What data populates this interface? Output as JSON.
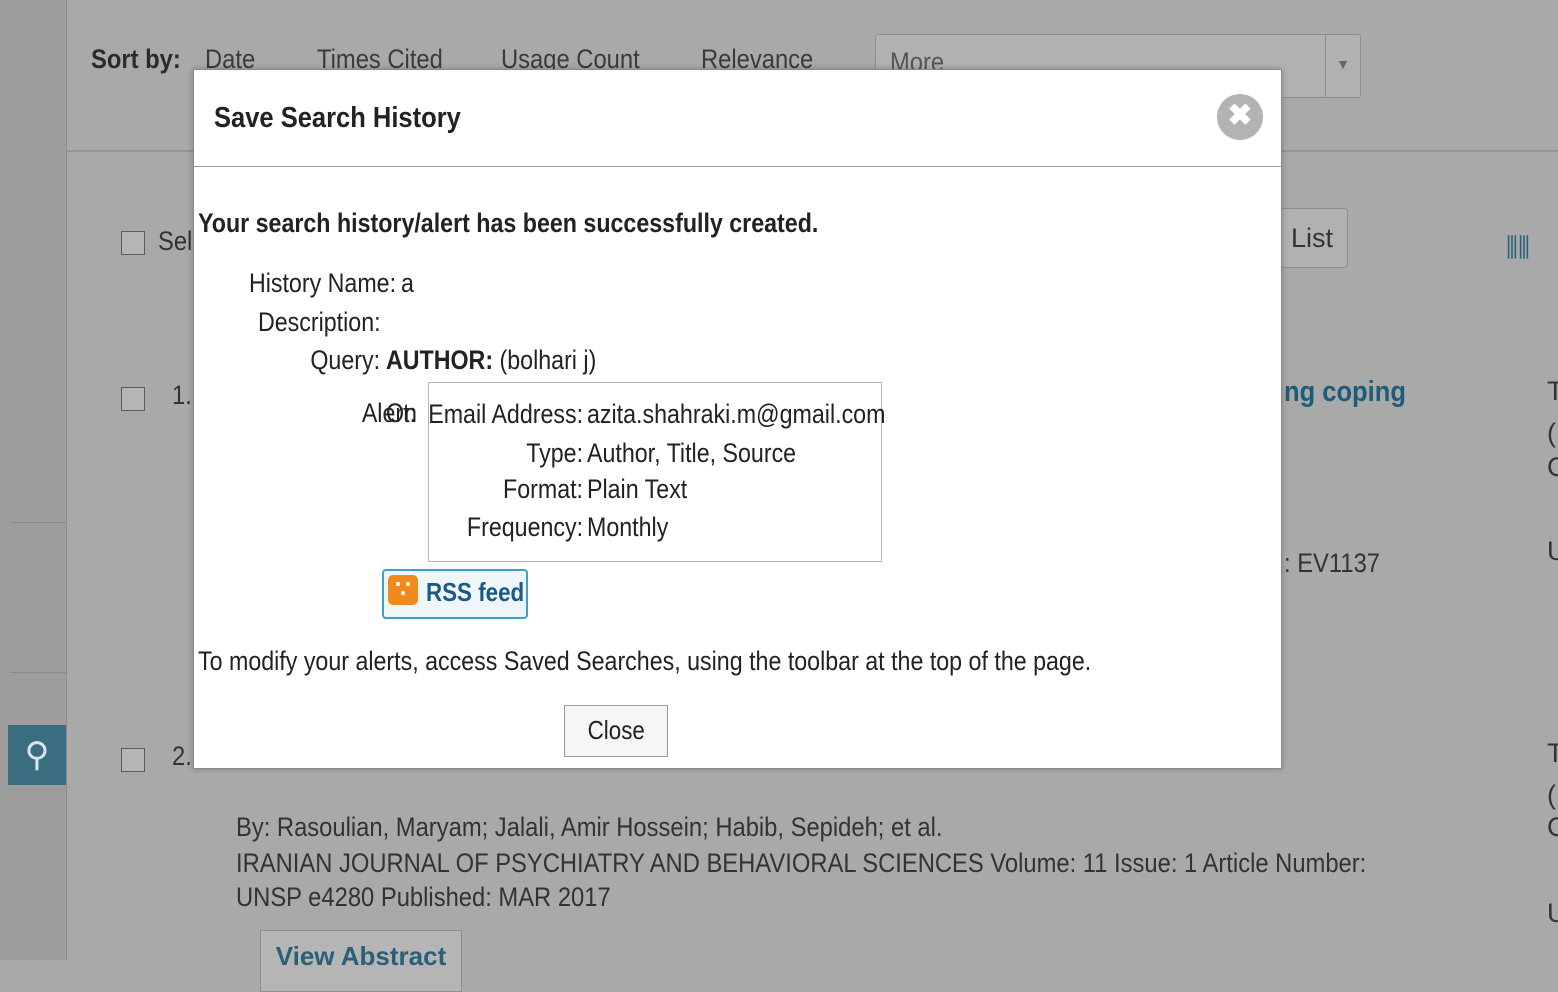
{
  "sort_bar": {
    "label": "Sort by:",
    "options": [
      "Date",
      "Times Cited",
      "Usage Count",
      "Relevance"
    ],
    "more_select": "More"
  },
  "results": {
    "select_label": "Sel",
    "list_button": "List",
    "item1": {
      "number": "1.",
      "title_fragment": "ng coping",
      "id_fragment": ": EV1137"
    },
    "item2": {
      "number": "2.",
      "authors": "By: Rasoulian, Maryam; Jalali, Amir Hossein; Habib, Sepideh; et al.",
      "source_line": "IRANIAN JOURNAL OF PSYCHIATRY AND BEHAVIORAL SCIENCES   Volume: 11   Issue: 1    Article Number:",
      "source_line2": "UNSP e4280   Published: MAR 2017",
      "view_abstract": "View Abstract"
    },
    "right_fragments": [
      "T",
      "(",
      "C",
      "U",
      "T",
      "(",
      "C",
      "U"
    ]
  },
  "modal": {
    "title": "Save Search History",
    "success_message": "Your search history/alert has been successfully created.",
    "history_name_label": "History Name:",
    "history_name_value": "a",
    "description_label": "Description:",
    "description_value": "",
    "query_label": "Query:",
    "query_field": "AUTHOR:",
    "query_value": "(bolhari j)",
    "alert_label": "Alert:",
    "alert_value": "On",
    "alert_details": {
      "email_label": "Email Address:",
      "email_value": "azita.shahraki.m@gmail.com",
      "type_label": "Type:",
      "type_value": "Author, Title, Source",
      "format_label": "Format:",
      "format_value": "Plain Text",
      "frequency_label": "Frequency:",
      "frequency_value": "Monthly"
    },
    "rss_label": "RSS feed",
    "modify_note": "To modify your alerts, access Saved Searches, using the toolbar at the top of the page.",
    "close_button": "Close"
  },
  "icons": {
    "close": "close-icon",
    "rss": "rss-icon",
    "search": "search-icon",
    "chart": "bar-chart-icon"
  },
  "colors": {
    "overlay_background": "#a9a9a9",
    "link_blue": "#1c5c78",
    "rss_orange": "#f08a1c",
    "search_rail": "#3a6d80"
  }
}
